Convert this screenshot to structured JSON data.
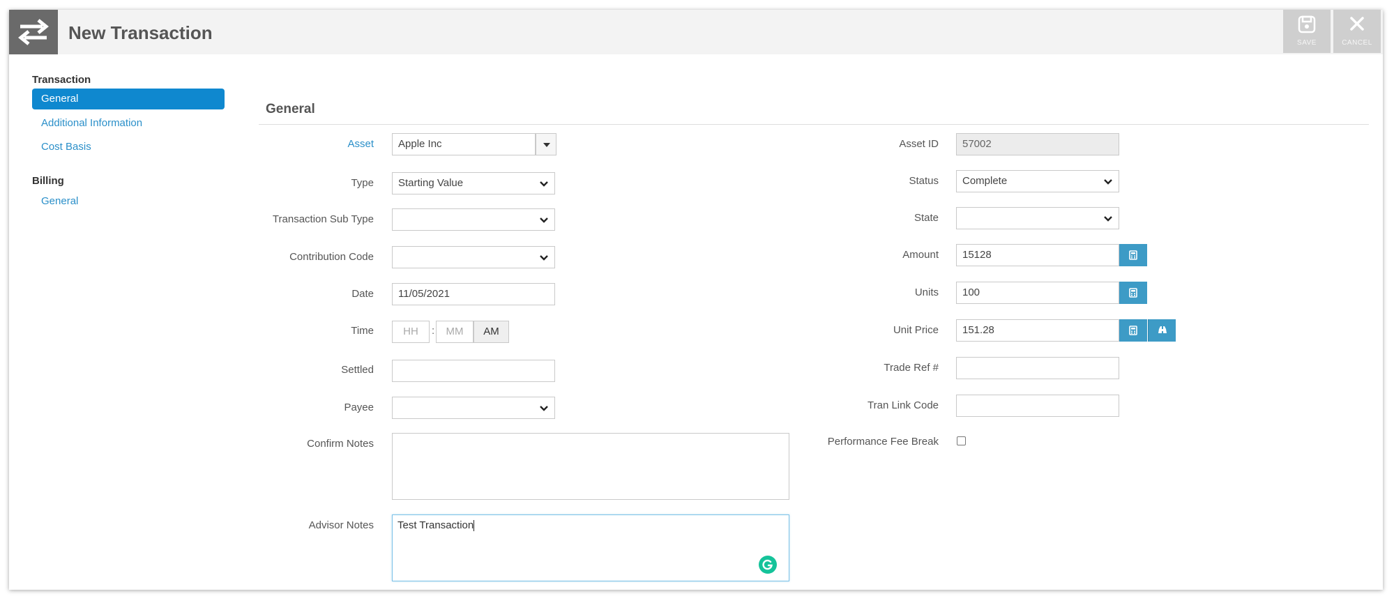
{
  "header": {
    "title": "New Transaction",
    "save_label": "SAVE",
    "cancel_label": "CANCEL"
  },
  "sidebar": {
    "groups": [
      {
        "title": "Transaction",
        "items": [
          "General",
          "Additional Information",
          "Cost Basis"
        ]
      },
      {
        "title": "Billing",
        "items": [
          "General"
        ]
      }
    ],
    "active": "Transaction / General"
  },
  "section": {
    "title": "General"
  },
  "left": {
    "asset": {
      "label": "Asset",
      "value": "Apple Inc"
    },
    "type": {
      "label": "Type",
      "value": "Starting Value"
    },
    "sub_type": {
      "label": "Transaction Sub Type",
      "value": ""
    },
    "contribution_code": {
      "label": "Contribution Code",
      "value": ""
    },
    "date": {
      "label": "Date",
      "value": "11/05/2021"
    },
    "time": {
      "label": "Time",
      "hh_placeholder": "HH",
      "mm_placeholder": "MM",
      "ampm": "AM",
      "separator": ":"
    },
    "settled": {
      "label": "Settled",
      "value": ""
    },
    "payee": {
      "label": "Payee",
      "value": ""
    },
    "confirm_notes": {
      "label": "Confirm Notes",
      "value": ""
    },
    "advisor_notes": {
      "label": "Advisor Notes",
      "value": "Test Transaction"
    }
  },
  "right": {
    "asset_id": {
      "label": "Asset ID",
      "value": "57002"
    },
    "status": {
      "label": "Status",
      "value": "Complete"
    },
    "state": {
      "label": "State",
      "value": ""
    },
    "amount": {
      "label": "Amount",
      "value": "15128"
    },
    "units": {
      "label": "Units",
      "value": "100"
    },
    "unit_price": {
      "label": "Unit Price",
      "value": "151.28"
    },
    "trade_ref": {
      "label": "Trade Ref #",
      "value": ""
    },
    "tran_link_code": {
      "label": "Tran Link Code",
      "value": ""
    },
    "performance_fee_break": {
      "label": "Performance Fee Break",
      "checked": false
    }
  },
  "colors": {
    "accent": "#0f88cf",
    "button": "#3d9bc6",
    "link": "#2a8fc9",
    "grammarly": "#15c39a"
  }
}
